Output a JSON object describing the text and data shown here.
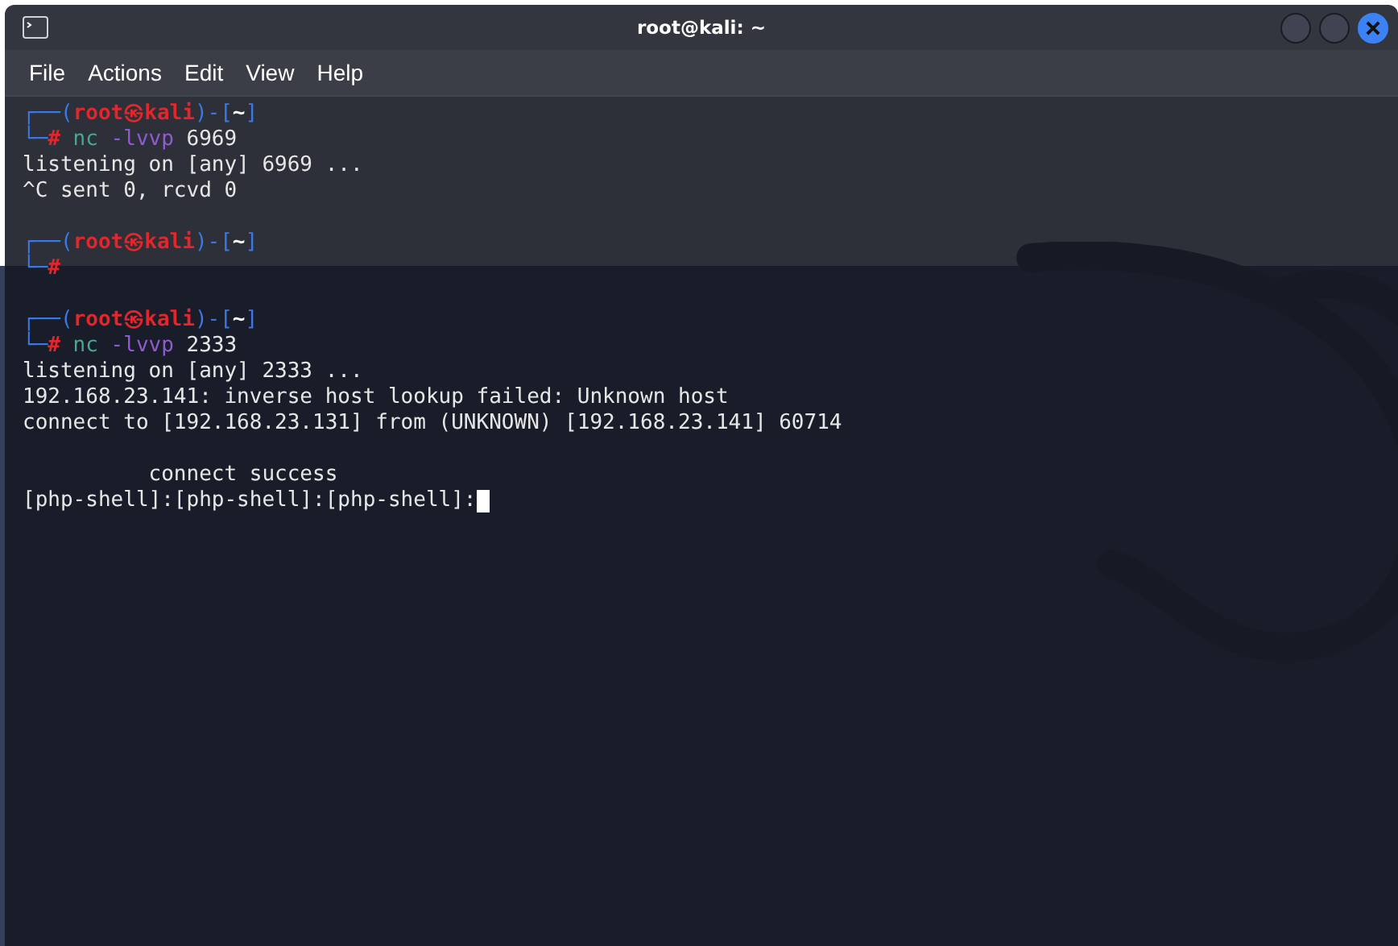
{
  "window": {
    "title": "root@kali: ~"
  },
  "menu": [
    "File",
    "Actions",
    "Edit",
    "View",
    "Help"
  ],
  "terminal": {
    "lines": [
      {
        "kind": "text",
        "segments": [
          {
            "kind": "frame",
            "text": "┌──("
          },
          {
            "kind": "user",
            "text": "root㉿kali"
          },
          {
            "kind": "frame",
            "text": ")-["
          },
          {
            "kind": "path",
            "text": "~"
          },
          {
            "kind": "frame",
            "text": "]"
          }
        ]
      },
      {
        "kind": "text",
        "segments": [
          {
            "kind": "frame",
            "text": "└─"
          },
          {
            "kind": "hash",
            "text": "#"
          },
          {
            "kind": "cmd",
            "text": " nc"
          },
          {
            "kind": "flag",
            "text": " -lvvp"
          },
          {
            "kind": "plain",
            "text": " 6969"
          }
        ]
      },
      {
        "kind": "text",
        "segments": [
          {
            "kind": "plain",
            "text": "listening on [any] 6969 ..."
          }
        ]
      },
      {
        "kind": "text",
        "segments": [
          {
            "kind": "plain",
            "text": "^C sent 0, rcvd 0"
          }
        ]
      },
      {
        "kind": "blank"
      },
      {
        "kind": "text",
        "segments": [
          {
            "kind": "frame",
            "text": "┌──("
          },
          {
            "kind": "user",
            "text": "root㉿kali"
          },
          {
            "kind": "frame",
            "text": ")-["
          },
          {
            "kind": "path",
            "text": "~"
          },
          {
            "kind": "frame",
            "text": "]"
          }
        ]
      },
      {
        "kind": "text",
        "segments": [
          {
            "kind": "frame",
            "text": "└─"
          },
          {
            "kind": "hash",
            "text": "#"
          }
        ]
      },
      {
        "kind": "blank"
      },
      {
        "kind": "text",
        "segments": [
          {
            "kind": "frame",
            "text": "┌──("
          },
          {
            "kind": "user",
            "text": "root㉿kali"
          },
          {
            "kind": "frame",
            "text": ")-["
          },
          {
            "kind": "path",
            "text": "~"
          },
          {
            "kind": "frame",
            "text": "]"
          }
        ]
      },
      {
        "kind": "text",
        "segments": [
          {
            "kind": "frame",
            "text": "└─"
          },
          {
            "kind": "hash",
            "text": "#"
          },
          {
            "kind": "cmd",
            "text": " nc"
          },
          {
            "kind": "flag",
            "text": " -lvvp"
          },
          {
            "kind": "plain",
            "text": " 2333"
          }
        ]
      },
      {
        "kind": "text",
        "segments": [
          {
            "kind": "plain",
            "text": "listening on [any] 2333 ..."
          }
        ]
      },
      {
        "kind": "text",
        "segments": [
          {
            "kind": "plain",
            "text": "192.168.23.141: inverse host lookup failed: Unknown host"
          }
        ]
      },
      {
        "kind": "text",
        "segments": [
          {
            "kind": "plain",
            "text": "connect to [192.168.23.131] from (UNKNOWN) [192.168.23.141] 60714"
          }
        ]
      },
      {
        "kind": "blank"
      },
      {
        "kind": "text",
        "segments": [
          {
            "kind": "plain",
            "text": "          connect success"
          }
        ]
      },
      {
        "kind": "text",
        "cursor": true,
        "segments": [
          {
            "kind": "plain",
            "text": "[php-shell]:[php-shell]:[php-shell]:"
          }
        ]
      }
    ]
  }
}
